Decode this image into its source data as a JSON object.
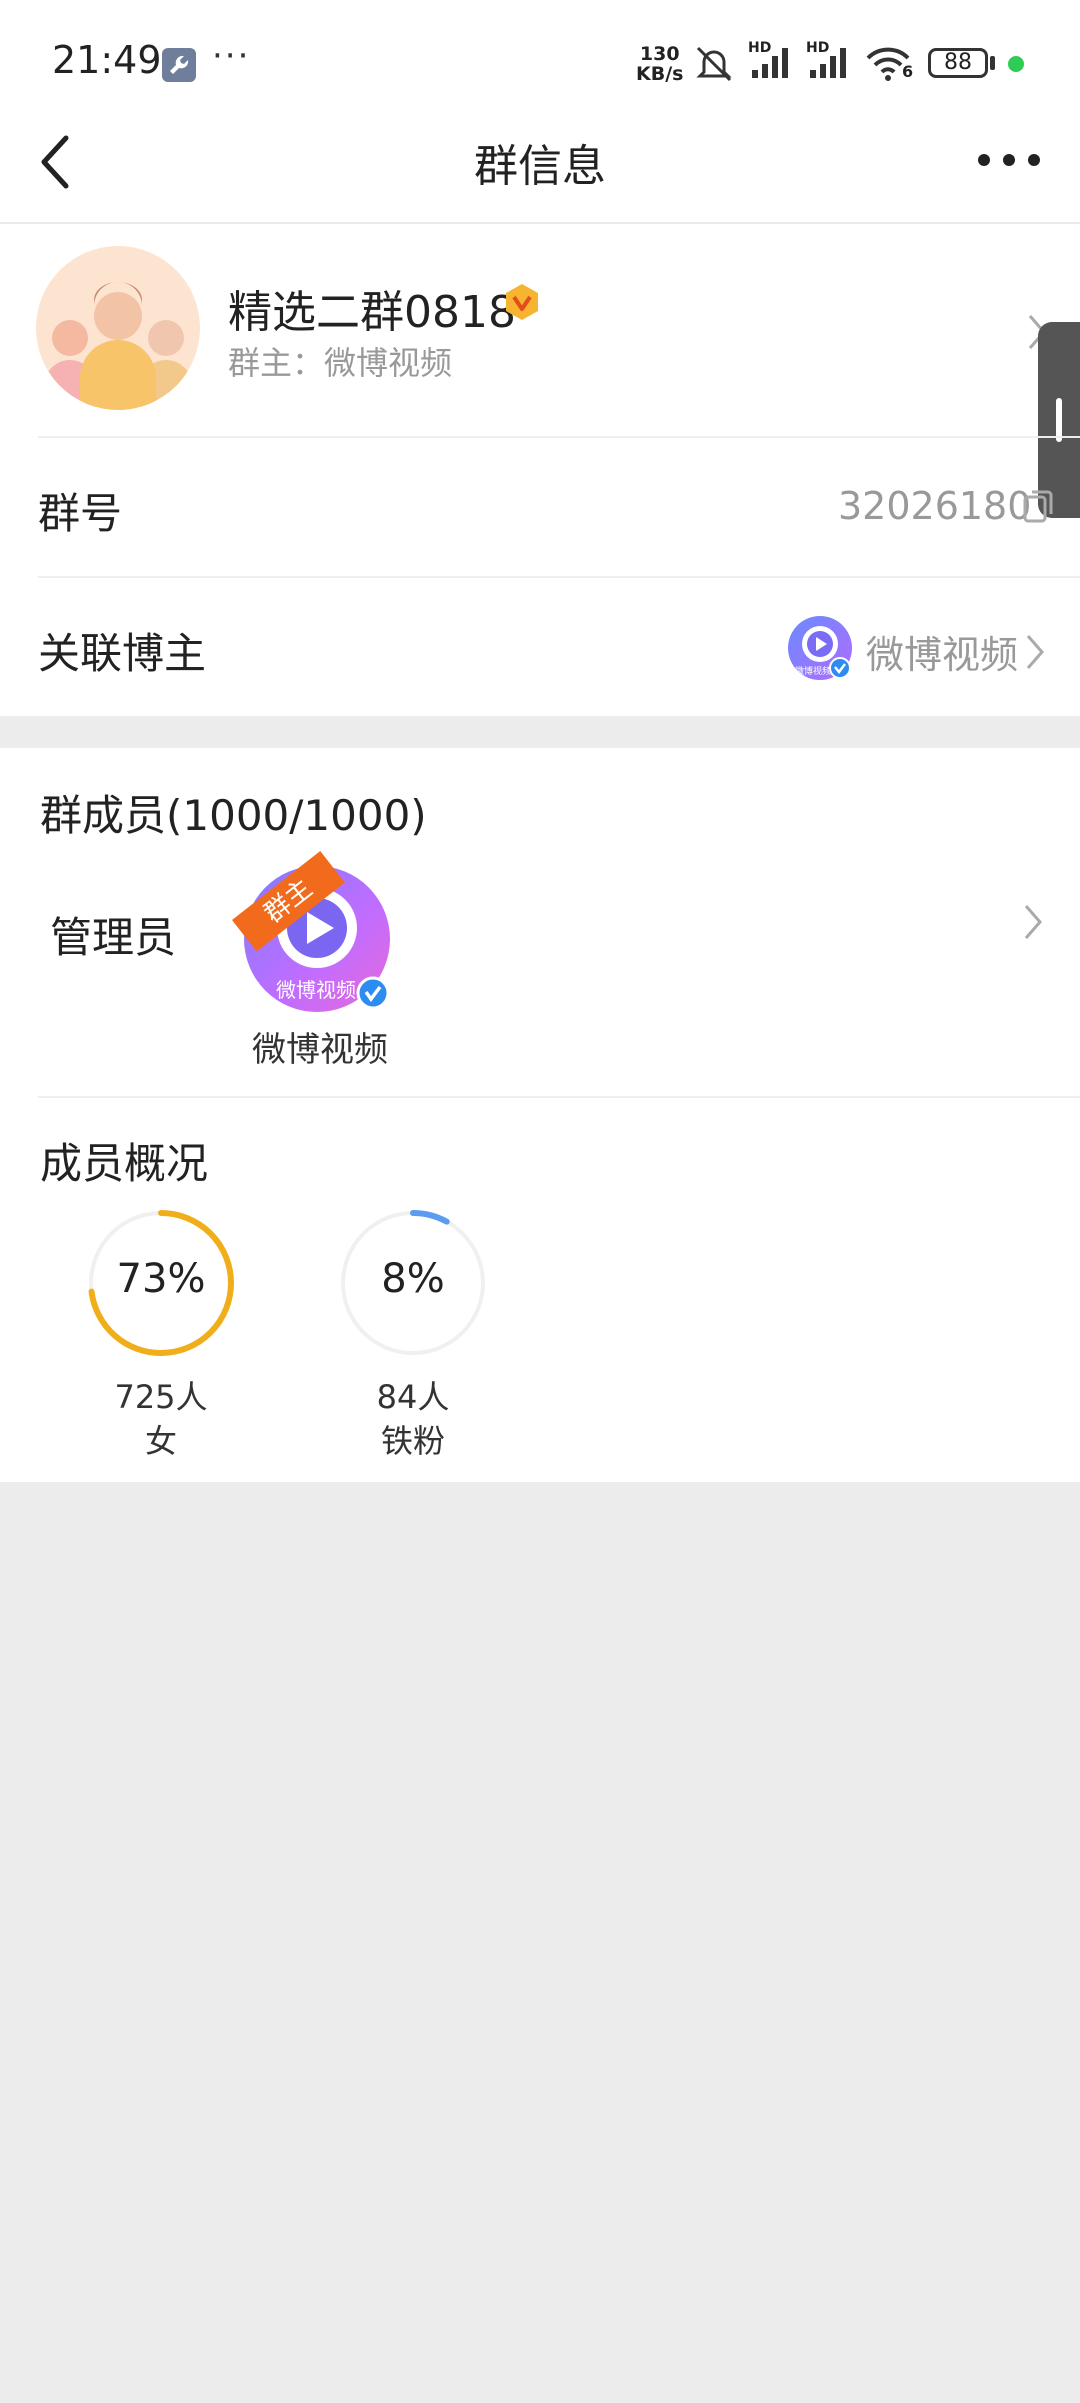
{
  "status_bar": {
    "time": "21:49",
    "more": "···",
    "net_speed_value": "130",
    "net_speed_unit": "KB/s",
    "hd1": "HD",
    "hd2": "HD",
    "wifi_gen": "6",
    "battery": "88"
  },
  "header": {
    "title": "群信息"
  },
  "group": {
    "name": "精选二群0818",
    "owner": "群主：微博视频"
  },
  "group_number": {
    "label": "群号",
    "value": "32026180"
  },
  "linked_blogger": {
    "label": "关联博主",
    "name": "微博视频",
    "avatar_text": "微博视频"
  },
  "members": {
    "title": "群成员(1000/1000)",
    "admin_label": "管理员",
    "owner_ribbon": "群主",
    "admin_avatar_text": "微博视频",
    "admin_name": "微博视频"
  },
  "overview": {
    "title": "成员概况",
    "stats": [
      {
        "percent_text": "73%",
        "percent": 0.73,
        "count": "725人",
        "label": "女",
        "color": "#f0ae1a"
      },
      {
        "percent_text": "8%",
        "percent": 0.08,
        "count": "84人",
        "label": "铁粉",
        "color": "#5b9cf0"
      }
    ]
  }
}
